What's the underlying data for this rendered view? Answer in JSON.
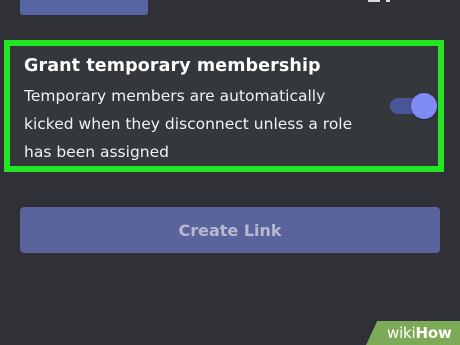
{
  "membership_setting": {
    "title": "Grant temporary membership",
    "description": "Temporary members are automatically kicked when they disconnect unless a role has been assigned",
    "toggle_enabled": true
  },
  "actions": {
    "create_link_label": "Create Link"
  },
  "watermark": {
    "brand_wiki": "wiki",
    "brand_how": "How"
  },
  "colors": {
    "background": "#2f3136",
    "panel": "#34373c",
    "highlight_border": "#24e522",
    "accent": "#7f8cf5",
    "button": "#5a639c"
  }
}
